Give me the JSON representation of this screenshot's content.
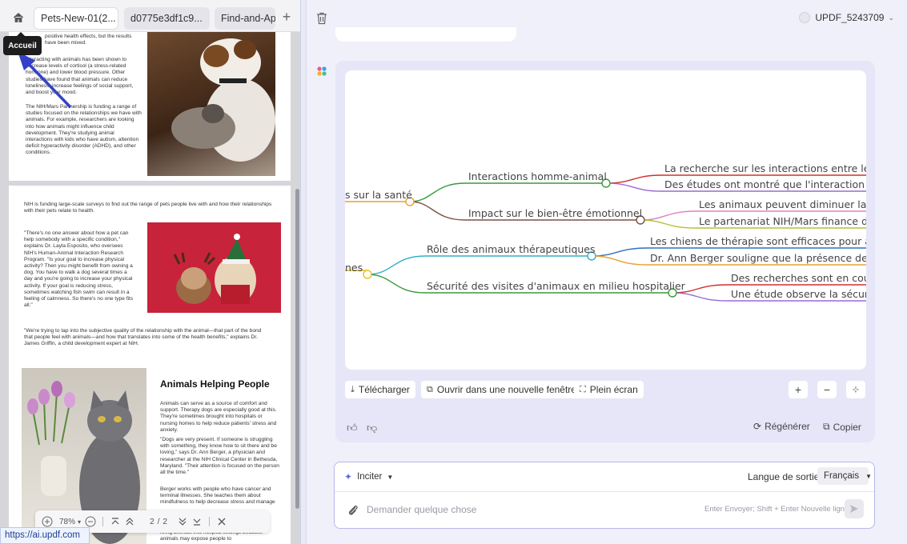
{
  "tabs": [
    {
      "label": "Pets-New-01(2...",
      "active": true
    },
    {
      "label": "d0775e3df1c9...",
      "active": false
    },
    {
      "label": "Find-and-Appl...",
      "active": false
    }
  ],
  "tooltip": "Accueil",
  "document": {
    "page1": {
      "para1": "positive health effects, but the results have been mixed.",
      "para2": "Interacting with animals has been shown to decrease levels of cortisol (a stress-related hormone) and lower blood pressure. Other studies have found that animals can reduce loneliness, increase feelings of social support, and boost your mood.",
      "para3": "The NIH/Mars Partnership is funding a range of studies focused on the relationships we have with animals. For example, researchers are looking into how animals might influence child development. They're studying animal interactions with kids who have autism, attention deficit hyperactivity disorder (ADHD), and other conditions."
    },
    "page2": {
      "intro": "NIH is funding large-scale surveys to find out the range of pets people live with and how their relationships with their pets relate to health.",
      "quote1": "\"There's no one answer about how a pet can help somebody with a specific condition,\" explains Dr. Layla Esposito, who oversees NIH's Human-Animal Interaction Research Program. \"Is your goal to increase physical activity? Then you might benefit from owning a dog. You have to walk a dog several times a day and you're going to increase your physical activity. If your goal is reducing stress, sometimes watching fish swim can result in a feeling of calmness. So there's no one type fits all.\"",
      "quote2": "\"We're trying to tap into the subjective quality of the relationship with the animal—that part of the bond that people feel with animals—and how that translates into some of the health benefits,\" explains Dr. James Griffin, a child development expert at NIH.",
      "heading": "Animals Helping People",
      "body1": "Animals can serve as a source of comfort and support. Therapy dogs are especially good at this. They're sometimes brought into hospitals or nursing homes to help reduce patients' stress and anxiety.",
      "body2": "\"Dogs are very present. If someone is struggling with something, they know how to sit there and be loving,\" says Dr. Ann Berger, a physician and researcher at the NIH Clinical Center in Bethesda, Maryland. \"Their attention is focused on the person all the time.\"",
      "body3": "Berger works with people who have cancer and terminal illnesses. She teaches them about mindfulness to help decrease stress and manage",
      "body4": "living animals into hospital settings because animals may expose people to"
    }
  },
  "zoom_toolbar": {
    "zoom": "78%",
    "page_current": "2",
    "page_sep": "/",
    "page_total": "2"
  },
  "status_url": "https://ai.updf.com",
  "user": {
    "name": "UPDF_5243709"
  },
  "mindmap": {
    "nodes": {
      "root_a": "s sur la santé",
      "interactions": "Interactions homme-animal",
      "research": "La recherche sur les interactions entre les h",
      "studies": "Des études ont montré que l'interaction av",
      "impact": "Impact sur le bien-être émotionnel",
      "reduce": "Les animaux peuvent diminuer la so",
      "partnership": "Le partenariat NIH/Mars finance de",
      "root_b": "nes",
      "therapy_role": "Rôle des animaux thérapeutiques",
      "therapy_dogs": "Les chiens de thérapie sont efficaces pour ap",
      "berger": "Dr. Ann Berger souligne que la présence des",
      "security": "Sécurité des visites d'animaux en milieu hospitalier",
      "research2": "Des recherches sont en cour",
      "study2": "Une étude observe la sécuri"
    }
  },
  "actions": {
    "download": "Télécharger",
    "open_new": "Ouvrir dans une nouvelle fenêtre",
    "fullscreen": "Plein écran",
    "regenerate": "Régénérer",
    "copy": "Copier"
  },
  "input": {
    "prompt_mode": "Inciter",
    "language_label": "Langue de sortie",
    "language_value": "Français",
    "placeholder": "Demander quelque chose",
    "hint": "Enter Envoyer; Shift + Enter Nouvelle ligne"
  },
  "colors": {
    "accent": "#6a6ae0",
    "card_bg": "#e6e6f8",
    "arrow": "#3341c8"
  }
}
